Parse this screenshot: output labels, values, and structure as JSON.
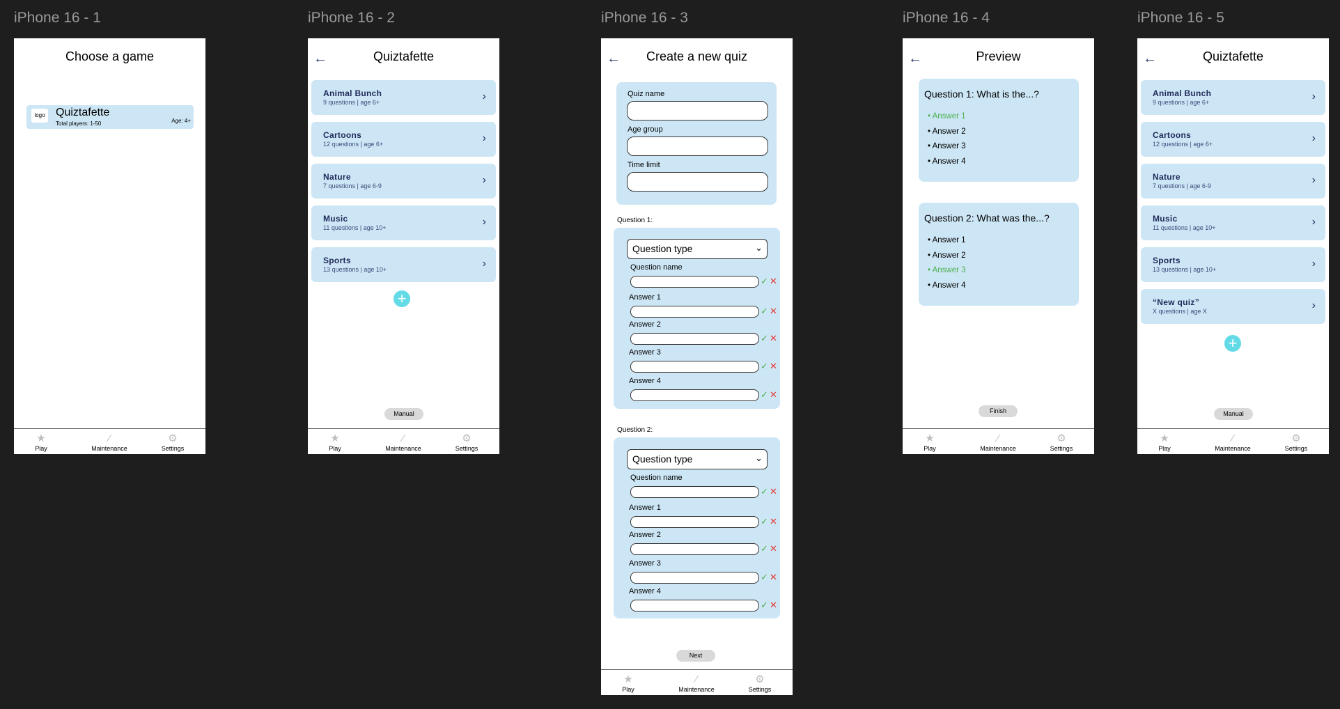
{
  "frames": [
    {
      "label": "iPhone 16 - 1"
    },
    {
      "label": "iPhone 16 - 2"
    },
    {
      "label": "iPhone 16 - 3"
    },
    {
      "label": "iPhone 16 - 4"
    },
    {
      "label": "iPhone 16 - 5"
    }
  ],
  "navbar": {
    "play": "Play",
    "maintenance": "Maintenance",
    "settings": "Settings"
  },
  "screen1": {
    "title": "Choose a game",
    "game": {
      "logo": "logo",
      "name": "Quiztafette",
      "players": "Total players: 1-50",
      "age": "Age: 4+"
    }
  },
  "screen2": {
    "title": "Quiztafette",
    "quizzes": [
      {
        "name": "Animal Bunch",
        "sub": "9 questions | age 6+"
      },
      {
        "name": "Cartoons",
        "sub": "12 questions | age 6+"
      },
      {
        "name": "Nature",
        "sub": "7 questions | age 6-9"
      },
      {
        "name": "Music",
        "sub": "11 questions | age 10+"
      },
      {
        "name": "Sports",
        "sub": "13 questions | age 10+"
      }
    ],
    "manual": "Manual"
  },
  "screen3": {
    "title": "Create a new quiz",
    "quiz_name": "Quiz name",
    "age_group": "Age group",
    "time_limit": "Time limit",
    "q1": "Question 1:",
    "q2": "Question 2:",
    "question_type": "Question type",
    "question_name": "Question name",
    "answers": [
      "Answer 1",
      "Answer 2",
      "Answer 3",
      "Answer 4"
    ],
    "next": "Next"
  },
  "screen4": {
    "title": "Preview",
    "q1": {
      "text": "Question 1: What is the...?",
      "answers": [
        "Answer 1",
        "Answer 2",
        "Answer 3",
        "Answer 4"
      ],
      "correct": 0
    },
    "q2": {
      "text": "Question 2: What was the...?",
      "answers": [
        "Answer 1",
        "Answer 2",
        "Answer 3",
        "Answer 4"
      ],
      "correct": 2
    },
    "finish": "Finish"
  },
  "screen5": {
    "title": "Quiztafette",
    "quizzes": [
      {
        "name": "Animal Bunch",
        "sub": "9 questions | age 6+"
      },
      {
        "name": "Cartoons",
        "sub": "12 questions | age 6+"
      },
      {
        "name": "Nature",
        "sub": "7 questions | age 6-9"
      },
      {
        "name": "Music",
        "sub": "11 questions | age 10+"
      },
      {
        "name": "Sports",
        "sub": "13 questions | age 10+"
      },
      {
        "name": "“New quiz”",
        "sub": "X questions | age X"
      }
    ],
    "manual": "Manual"
  },
  "colors": {
    "card": "#cde6f5",
    "plus": "#62dbe6",
    "correct": "#4caf50",
    "wrong": "#e53935",
    "navy": "#1e2a5a"
  }
}
